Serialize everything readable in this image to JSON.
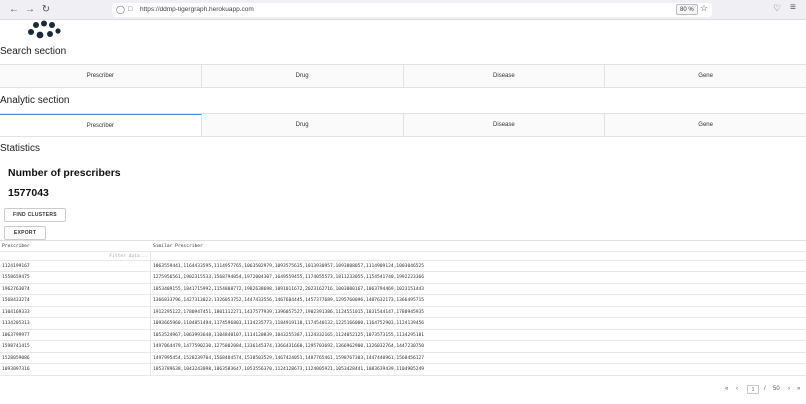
{
  "browser": {
    "url": "https://ddmp-tigergraph.herokuapp.com",
    "zoom": "80 %",
    "icons": [
      "back-icon",
      "forward-icon",
      "reload-icon",
      "shield-icon",
      "lock-icon",
      "star-icon",
      "pocket-icon",
      "menu-icon"
    ]
  },
  "search_section": {
    "title": "Search section",
    "tabs": [
      "Prescriber",
      "Drug",
      "Disease",
      "Gene"
    ]
  },
  "analytic_section": {
    "title": "Analytic section",
    "tabs": [
      "Prescriber",
      "Drug",
      "Disease",
      "Gene"
    ],
    "active_tab": "Prescriber"
  },
  "statistics": {
    "title": "Statistics",
    "metric_label": "Number of prescribers",
    "metric_value": "1577043",
    "find_clusters_label": "FIND CLUSTERS",
    "export_label": "EXPORT"
  },
  "grid": {
    "columns": [
      "Prescriber",
      "Similar Prescriber"
    ],
    "filter_placeholder": "Filter data...",
    "rows": [
      {
        "prescriber": "1124199167",
        "similar": "1063559441,1164433595,1114957765,1063502979,1093575635,1013930957,1093808057,1114909124,1003046525"
      },
      {
        "prescriber": "1558659475",
        "similar": "1275956561,1902315533,1568794054,1972004307,1649559455,1174055573,1811233055,1154541740,1992223366"
      },
      {
        "prescriber": "1962763074",
        "similar": "1053409155,1841715992,1154808772,1982638698,1891011672,2023162716,1003000167,1063794469,1023151443"
      },
      {
        "prescriber": "1568433274",
        "similar": "1366833796,1427313022,1326053752,1447433556,1467684445,1457377689,1295760096,1407632173,1366495715"
      },
      {
        "prescriber": "1104169333",
        "similar": "1912295122,1780947451,1801112271,1437577939,1396057527,1902391386,1124551015,1831544147,1780945935"
      },
      {
        "prescriber": "1134205313",
        "similar": "1093665960,1104851494,1174596803,1134235773,1184919110,1174540132,1225166000,1164752903,1124139456"
      },
      {
        "prescriber": "1063799977",
        "similar": "1053524967,1063993648,1104840107,1114120839,1043255387,1124332165,1124052125,1073573155,1134295181"
      },
      {
        "prescriber": "1598741415",
        "similar": "1497064479,1477590230,1275802084,1336145374,1366431660,1295703692,1366962900,1326032764,1447230750"
      },
      {
        "prescriber": "1528059086",
        "similar": "1497995454,1528239704,1568484574,1538503529,1467424051,1487765461,1598767303,1447440961,1568456127"
      },
      {
        "prescriber": "1093097316",
        "similar": "1053789638,1043243098,1063583647,1053556370,1124128673,1124005921,1053428441,1083639439,1104905249"
      }
    ]
  },
  "pager": {
    "first": "«",
    "prev": "‹",
    "current": "1",
    "separator": "/",
    "total": "50",
    "next": "›",
    "last": "»"
  }
}
